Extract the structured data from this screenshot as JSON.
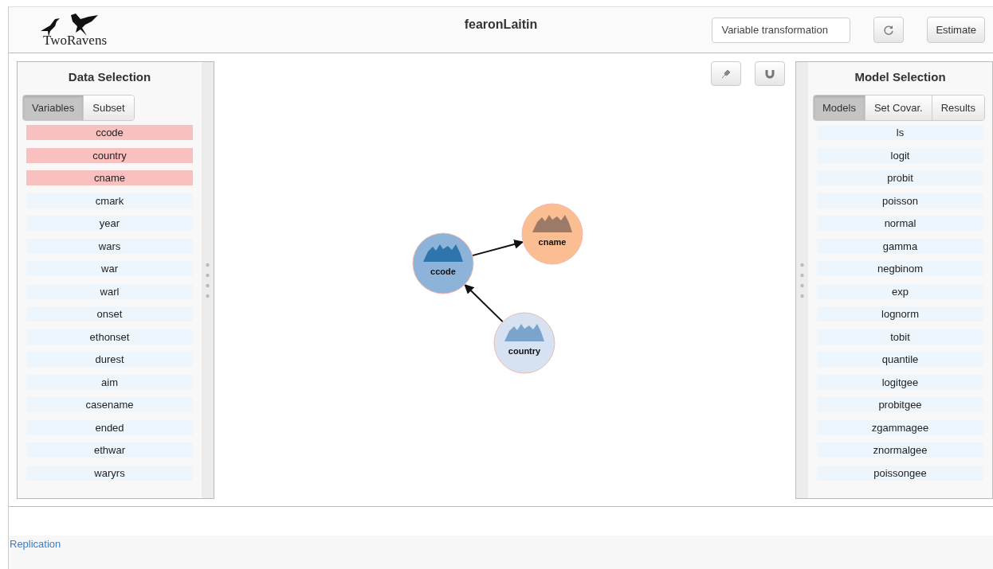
{
  "header": {
    "logo": "TwoRavens",
    "title": "fearonLaitin",
    "transform_field": {
      "placeholder": "Variable transformation"
    },
    "estimate_button": "Estimate"
  },
  "data_selection": {
    "title": "Data Selection",
    "tabs": [
      {
        "label": "Variables",
        "selected": true
      },
      {
        "label": "Subset",
        "selected": false
      }
    ],
    "variables": [
      {
        "name": "ccode",
        "selected": true
      },
      {
        "name": "country",
        "selected": true
      },
      {
        "name": "cname",
        "selected": true
      },
      {
        "name": "cmark",
        "selected": false
      },
      {
        "name": "year",
        "selected": false
      },
      {
        "name": "wars",
        "selected": false
      },
      {
        "name": "war",
        "selected": false
      },
      {
        "name": "warl",
        "selected": false
      },
      {
        "name": "onset",
        "selected": false
      },
      {
        "name": "ethonset",
        "selected": false
      },
      {
        "name": "durest",
        "selected": false
      },
      {
        "name": "aim",
        "selected": false
      },
      {
        "name": "casename",
        "selected": false
      },
      {
        "name": "ended",
        "selected": false
      },
      {
        "name": "ethwar",
        "selected": false
      },
      {
        "name": "waryrs",
        "selected": false
      }
    ]
  },
  "graph": {
    "nodes": [
      {
        "name": "ccode",
        "color": "#8db4d8"
      },
      {
        "name": "cname",
        "color": "#fbbe92"
      },
      {
        "name": "country",
        "color": "#d6e1f1"
      }
    ]
  },
  "model_selection": {
    "title": "Model Selection",
    "tabs": [
      {
        "label": "Models",
        "selected": true
      },
      {
        "label": "Set Covar.",
        "selected": false
      },
      {
        "label": "Results",
        "selected": false
      }
    ],
    "models": [
      {
        "name": "ls",
        "selected": false
      },
      {
        "name": "logit",
        "selected": false
      },
      {
        "name": "probit",
        "selected": false
      },
      {
        "name": "poisson",
        "selected": false
      },
      {
        "name": "normal",
        "selected": false
      },
      {
        "name": "gamma",
        "selected": false
      },
      {
        "name": "negbinom",
        "selected": false
      },
      {
        "name": "exp",
        "selected": false
      },
      {
        "name": "lognorm",
        "selected": false
      },
      {
        "name": "tobit",
        "selected": false
      },
      {
        "name": "quantile",
        "selected": false
      },
      {
        "name": "logitgee",
        "selected": false
      },
      {
        "name": "probitgee",
        "selected": false
      },
      {
        "name": "zgammagee",
        "selected": false
      },
      {
        "name": "znormalgee",
        "selected": false
      },
      {
        "name": "poissongee",
        "selected": false
      }
    ]
  },
  "footer": {
    "link": "Replication"
  }
}
